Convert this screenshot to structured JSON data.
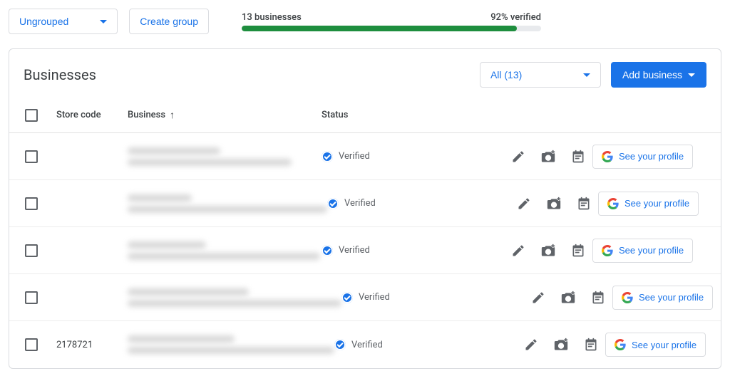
{
  "toolbar": {
    "group_dropdown_label": "Ungrouped",
    "create_group_label": "Create group"
  },
  "progress": {
    "count_text": "13 businesses",
    "verified_text": "92% verified",
    "percent": 92
  },
  "card": {
    "title": "Businesses",
    "filter_label": "All (13)",
    "add_label": "Add business"
  },
  "columns": {
    "store_code": "Store code",
    "business": "Business",
    "status": "Status"
  },
  "status_label": "Verified",
  "profile_button_label": "See your profile",
  "rows": [
    {
      "store_code": "",
      "blur": {
        "w1": 130,
        "w2": 230
      }
    },
    {
      "store_code": "",
      "blur": {
        "w1": 90,
        "w2": 280
      }
    },
    {
      "store_code": "",
      "blur": {
        "w1": 110,
        "w2": 270
      }
    },
    {
      "store_code": "",
      "blur": {
        "w1": 170,
        "w2": 300
      }
    },
    {
      "store_code": "2178721",
      "blur": {
        "w1": 150,
        "w2": 290
      }
    }
  ]
}
